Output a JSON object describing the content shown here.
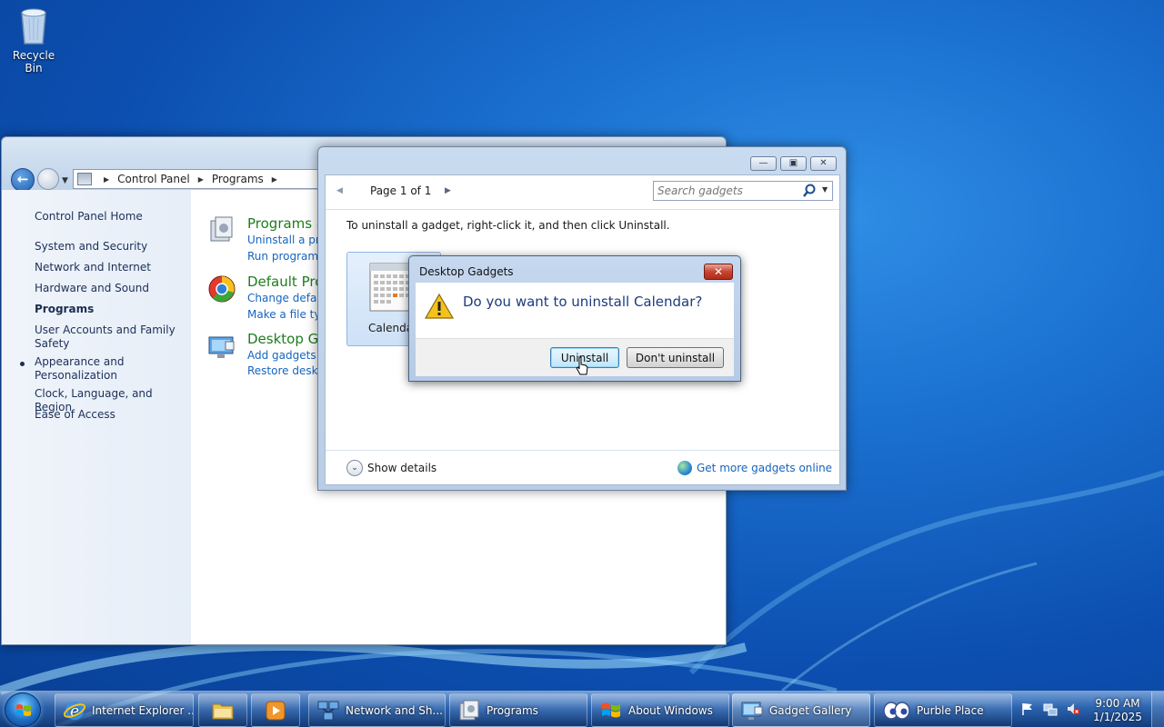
{
  "desktop": {
    "recycle_bin_label": "Recycle Bin"
  },
  "control_panel": {
    "breadcrumb": [
      "Control Panel",
      "Programs"
    ],
    "sidebar": [
      "Control Panel Home",
      "System and Security",
      "Network and Internet",
      "Hardware and Sound",
      "Programs",
      "User Accounts and Family Safety",
      "Appearance and Personalization",
      "Clock, Language, and Region",
      "Ease of Access"
    ],
    "categories": [
      {
        "title": "Programs a",
        "links": [
          "Uninstall a prog",
          "Run programs"
        ]
      },
      {
        "title": "Default Pro",
        "links": [
          "Change default",
          "Make a file typ"
        ]
      },
      {
        "title": "Desktop Ga",
        "links": [
          "Add gadgets to",
          "Restore desktop"
        ]
      }
    ]
  },
  "gadget_gallery": {
    "pager": "Page 1 of 1",
    "search_placeholder": "Search gadgets",
    "instruction": "To uninstall a gadget, right-click it, and then click Uninstall.",
    "gadget_label": "Calendar",
    "show_details": "Show details",
    "get_more": "Get more gadgets online"
  },
  "dialog": {
    "title": "Desktop Gadgets",
    "message": "Do you want to uninstall Calendar?",
    "uninstall_label": "Uninstall",
    "dont_uninstall_label": "Don't uninstall"
  },
  "taskbar": {
    "items": [
      {
        "label": "Internet Explorer ...",
        "icon": "internet-explorer-icon"
      },
      {
        "label": "",
        "icon": "folder-icon"
      },
      {
        "label": "",
        "icon": "media-player-icon"
      },
      {
        "label": "Network and Sh...",
        "icon": "network-icon"
      },
      {
        "label": "Programs",
        "icon": "programs-icon"
      },
      {
        "label": "About Windows",
        "icon": "windows-logo-icon"
      },
      {
        "label": "Gadget Gallery",
        "icon": "gadget-gallery-icon"
      },
      {
        "label": "Purble Place",
        "icon": "purble-place-icon"
      }
    ],
    "clock_time": "9:00 AM",
    "clock_date": "1/1/2025"
  }
}
